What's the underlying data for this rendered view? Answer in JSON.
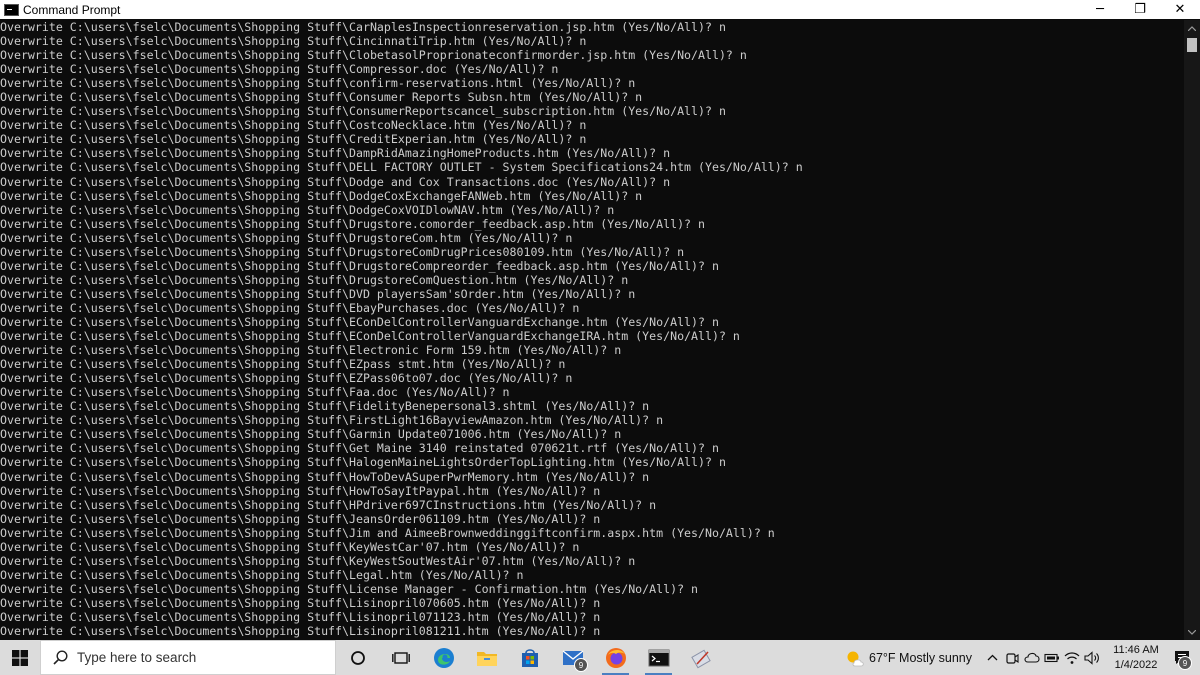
{
  "window": {
    "title": "Command Prompt",
    "controls": {
      "minimize": "─",
      "maximize": "❐",
      "close": "✕"
    }
  },
  "console": {
    "lines": [
      "Overwrite C:\\users\\fselc\\Documents\\Shopping Stuff\\CarNaplesInspectionreservation.jsp.htm (Yes/No/All)? n",
      "Overwrite C:\\users\\fselc\\Documents\\Shopping Stuff\\CincinnatiTrip.htm (Yes/No/All)? n",
      "Overwrite C:\\users\\fselc\\Documents\\Shopping Stuff\\ClobetasolProprionateconfirmorder.jsp.htm (Yes/No/All)? n",
      "Overwrite C:\\users\\fselc\\Documents\\Shopping Stuff\\Compressor.doc (Yes/No/All)? n",
      "Overwrite C:\\users\\fselc\\Documents\\Shopping Stuff\\confirm-reservations.html (Yes/No/All)? n",
      "Overwrite C:\\users\\fselc\\Documents\\Shopping Stuff\\Consumer Reports Subsn.htm (Yes/No/All)? n",
      "Overwrite C:\\users\\fselc\\Documents\\Shopping Stuff\\ConsumerReportscancel_subscription.htm (Yes/No/All)? n",
      "Overwrite C:\\users\\fselc\\Documents\\Shopping Stuff\\CostcoNecklace.htm (Yes/No/All)? n",
      "Overwrite C:\\users\\fselc\\Documents\\Shopping Stuff\\CreditExperian.htm (Yes/No/All)? n",
      "Overwrite C:\\users\\fselc\\Documents\\Shopping Stuff\\DampRidAmazingHomeProducts.htm (Yes/No/All)? n",
      "Overwrite C:\\users\\fselc\\Documents\\Shopping Stuff\\DELL FACTORY OUTLET - System Specifications24.htm (Yes/No/All)? n",
      "Overwrite C:\\users\\fselc\\Documents\\Shopping Stuff\\Dodge and Cox Transactions.doc (Yes/No/All)? n",
      "Overwrite C:\\users\\fselc\\Documents\\Shopping Stuff\\DodgeCoxExchangeFANWeb.htm (Yes/No/All)? n",
      "Overwrite C:\\users\\fselc\\Documents\\Shopping Stuff\\DodgeCoxVOIDlowNAV.htm (Yes/No/All)? n",
      "Overwrite C:\\users\\fselc\\Documents\\Shopping Stuff\\Drugstore.comorder_feedback.asp.htm (Yes/No/All)? n",
      "Overwrite C:\\users\\fselc\\Documents\\Shopping Stuff\\DrugstoreCom.htm (Yes/No/All)? n",
      "Overwrite C:\\users\\fselc\\Documents\\Shopping Stuff\\DrugstoreComDrugPrices080109.htm (Yes/No/All)? n",
      "Overwrite C:\\users\\fselc\\Documents\\Shopping Stuff\\DrugstoreCompreorder_feedback.asp.htm (Yes/No/All)? n",
      "Overwrite C:\\users\\fselc\\Documents\\Shopping Stuff\\DrugstoreComQuestion.htm (Yes/No/All)? n",
      "Overwrite C:\\users\\fselc\\Documents\\Shopping Stuff\\DVD playersSam'sOrder.htm (Yes/No/All)? n",
      "Overwrite C:\\users\\fselc\\Documents\\Shopping Stuff\\EbayPurchases.doc (Yes/No/All)? n",
      "Overwrite C:\\users\\fselc\\Documents\\Shopping Stuff\\EConDelControllerVanguardExchange.htm (Yes/No/All)? n",
      "Overwrite C:\\users\\fselc\\Documents\\Shopping Stuff\\EConDelControllerVanguardExchangeIRA.htm (Yes/No/All)? n",
      "Overwrite C:\\users\\fselc\\Documents\\Shopping Stuff\\Electronic Form 159.htm (Yes/No/All)? n",
      "Overwrite C:\\users\\fselc\\Documents\\Shopping Stuff\\EZpass stmt.htm (Yes/No/All)? n",
      "Overwrite C:\\users\\fselc\\Documents\\Shopping Stuff\\EZPass06to07.doc (Yes/No/All)? n",
      "Overwrite C:\\users\\fselc\\Documents\\Shopping Stuff\\Faa.doc (Yes/No/All)? n",
      "Overwrite C:\\users\\fselc\\Documents\\Shopping Stuff\\FidelityBenepersonal3.shtml (Yes/No/All)? n",
      "Overwrite C:\\users\\fselc\\Documents\\Shopping Stuff\\FirstLight16BayviewAmazon.htm (Yes/No/All)? n",
      "Overwrite C:\\users\\fselc\\Documents\\Shopping Stuff\\Garmin Update071006.htm (Yes/No/All)? n",
      "Overwrite C:\\users\\fselc\\Documents\\Shopping Stuff\\Get Maine 3140 reinstated 070621t.rtf (Yes/No/All)? n",
      "Overwrite C:\\users\\fselc\\Documents\\Shopping Stuff\\HalogenMaineLightsOrderTopLighting.htm (Yes/No/All)? n",
      "Overwrite C:\\users\\fselc\\Documents\\Shopping Stuff\\HowToDevASuperPwrMemory.htm (Yes/No/All)? n",
      "Overwrite C:\\users\\fselc\\Documents\\Shopping Stuff\\HowToSayItPaypal.htm (Yes/No/All)? n",
      "Overwrite C:\\users\\fselc\\Documents\\Shopping Stuff\\HPdriver697CInstructions.htm (Yes/No/All)? n",
      "Overwrite C:\\users\\fselc\\Documents\\Shopping Stuff\\JeansOrder061109.htm (Yes/No/All)? n",
      "Overwrite C:\\users\\fselc\\Documents\\Shopping Stuff\\Jim and AimeeBrownweddinggiftconfirm.aspx.htm (Yes/No/All)? n",
      "Overwrite C:\\users\\fselc\\Documents\\Shopping Stuff\\KeyWestCar'07.htm (Yes/No/All)? n",
      "Overwrite C:\\users\\fselc\\Documents\\Shopping Stuff\\KeyWestSoutWestAir'07.htm (Yes/No/All)? n",
      "Overwrite C:\\users\\fselc\\Documents\\Shopping Stuff\\Legal.htm (Yes/No/All)? n",
      "Overwrite C:\\users\\fselc\\Documents\\Shopping Stuff\\License Manager - Confirmation.htm (Yes/No/All)? n",
      "Overwrite C:\\users\\fselc\\Documents\\Shopping Stuff\\Lisinopril070605.htm (Yes/No/All)? n",
      "Overwrite C:\\users\\fselc\\Documents\\Shopping Stuff\\Lisinopril071123.htm (Yes/No/All)? n",
      "Overwrite C:\\users\\fselc\\Documents\\Shopping Stuff\\Lisinopril081211.htm (Yes/No/All)? n"
    ]
  },
  "taskbar": {
    "search_placeholder": "Type here to search",
    "mail_badge": "9",
    "weather": "67°F  Mostly sunny",
    "time": "11:46 AM",
    "date": "1/4/2022",
    "notification_badge": "9"
  },
  "colors": {
    "console_bg": "#0c0c0c",
    "console_text": "#cccccc",
    "taskbar_bg": "#dcdcdc"
  }
}
